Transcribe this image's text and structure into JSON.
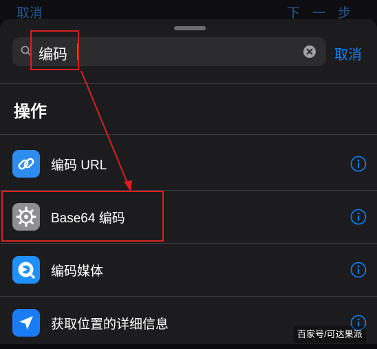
{
  "underlay": {
    "left_label": "取消",
    "right_label": "下一步"
  },
  "search": {
    "value": "编码",
    "icons": {
      "search": "magnifying-glass-icon",
      "clear": "clear-circle-icon"
    }
  },
  "cancel_label": "取消",
  "section_title": "操作",
  "actions": [
    {
      "label": "编码 URL",
      "icon": "link-icon",
      "icon_color": "#2d8cf0"
    },
    {
      "label": "Base64 编码",
      "icon": "gear-icon",
      "icon_color": "#8e8e93"
    },
    {
      "label": "编码媒体",
      "icon": "quicktime-icon",
      "icon_color": "#1e90ff"
    },
    {
      "label": "获取位置的详细信息",
      "icon": "location-arrow-icon",
      "icon_color": "#1a7cf5"
    }
  ],
  "info_icon": "info-circle-icon",
  "watermark": "百家号/可达果派",
  "colors": {
    "accent": "#0a84ff",
    "sheet_background": "#1c1c1e",
    "field_background": "#2c2c2e",
    "annotation": "#d8201f"
  }
}
